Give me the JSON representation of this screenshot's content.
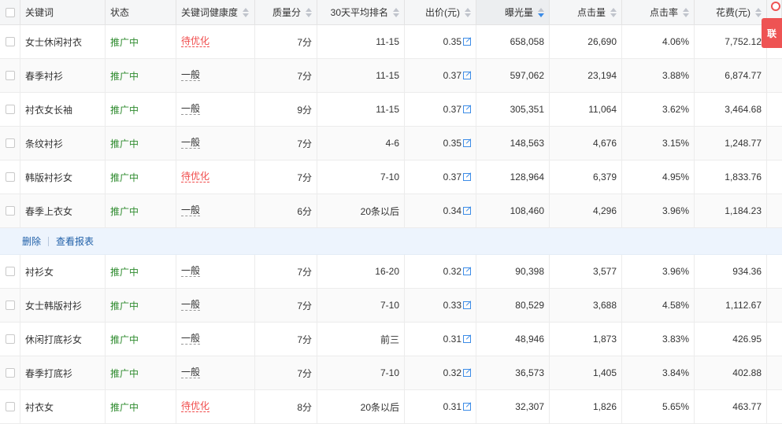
{
  "columns": {
    "keyword": "关键词",
    "status": "状态",
    "health": "关键词健康度",
    "quality": "质量分",
    "rank30": "30天平均排名",
    "bid": "出价(元)",
    "impressions": "曝光量",
    "clicks": "点击量",
    "ctr": "点击率",
    "cost": "花费(元)"
  },
  "colors": {
    "status_green": "#2e8b2e",
    "warn_red": "#f04a4a",
    "link_blue": "#1f5fa8",
    "sort_active": "#3c8ce7"
  },
  "icons": {
    "edit": "edit-icon",
    "sort": "sort-icon",
    "checkbox": "checkbox"
  },
  "rows_top": [
    {
      "keyword": "女士休闲衬衣",
      "status": "推广中",
      "health": "待优化",
      "warn": true,
      "quality": "7分",
      "rank": "11-15",
      "bid": "0.35",
      "impressions": "658,058",
      "clicks": "26,690",
      "ctr": "4.06%",
      "cost": "7,752.12"
    },
    {
      "keyword": "春季衬衫",
      "status": "推广中",
      "health": "一般",
      "warn": false,
      "quality": "7分",
      "rank": "11-15",
      "bid": "0.37",
      "impressions": "597,062",
      "clicks": "23,194",
      "ctr": "3.88%",
      "cost": "6,874.77"
    },
    {
      "keyword": "衬衣女长袖",
      "status": "推广中",
      "health": "一般",
      "warn": false,
      "quality": "9分",
      "rank": "11-15",
      "bid": "0.37",
      "impressions": "305,351",
      "clicks": "11,064",
      "ctr": "3.62%",
      "cost": "3,464.68"
    },
    {
      "keyword": "条纹衬衫",
      "status": "推广中",
      "health": "一般",
      "warn": false,
      "quality": "7分",
      "rank": "4-6",
      "bid": "0.35",
      "impressions": "148,563",
      "clicks": "4,676",
      "ctr": "3.15%",
      "cost": "1,248.77"
    },
    {
      "keyword": "韩版衬衫女",
      "status": "推广中",
      "health": "待优化",
      "warn": true,
      "quality": "7分",
      "rank": "7-10",
      "bid": "0.37",
      "impressions": "128,964",
      "clicks": "6,379",
      "ctr": "4.95%",
      "cost": "1,833.76"
    },
    {
      "keyword": "春季上衣女",
      "status": "推广中",
      "health": "一般",
      "warn": false,
      "quality": "6分",
      "rank": "20条以后",
      "bid": "0.34",
      "impressions": "108,460",
      "clicks": "4,296",
      "ctr": "3.96%",
      "cost": "1,184.23"
    }
  ],
  "actions": {
    "delete": "删除",
    "report": "查看报表"
  },
  "rows_bottom": [
    {
      "keyword": "衬衫女",
      "status": "推广中",
      "health": "一般",
      "warn": false,
      "quality": "7分",
      "rank": "16-20",
      "bid": "0.32",
      "impressions": "90,398",
      "clicks": "3,577",
      "ctr": "3.96%",
      "cost": "934.36"
    },
    {
      "keyword": "女士韩版衬衫",
      "status": "推广中",
      "health": "一般",
      "warn": false,
      "quality": "7分",
      "rank": "7-10",
      "bid": "0.33",
      "impressions": "80,529",
      "clicks": "3,688",
      "ctr": "4.58%",
      "cost": "1,112.67"
    },
    {
      "keyword": "休闲打底衫女",
      "status": "推广中",
      "health": "一般",
      "warn": false,
      "quality": "7分",
      "rank": "前三",
      "bid": "0.31",
      "impressions": "48,946",
      "clicks": "1,873",
      "ctr": "3.83%",
      "cost": "426.95"
    },
    {
      "keyword": "春季打底衫",
      "status": "推广中",
      "health": "一般",
      "warn": false,
      "quality": "7分",
      "rank": "7-10",
      "bid": "0.32",
      "impressions": "36,573",
      "clicks": "1,405",
      "ctr": "3.84%",
      "cost": "402.88"
    },
    {
      "keyword": "衬衣女",
      "status": "推广中",
      "health": "待优化",
      "warn": true,
      "quality": "8分",
      "rank": "20条以后",
      "bid": "0.31",
      "impressions": "32,307",
      "clicks": "1,826",
      "ctr": "5.65%",
      "cost": "463.77"
    }
  ],
  "float_button": "联"
}
